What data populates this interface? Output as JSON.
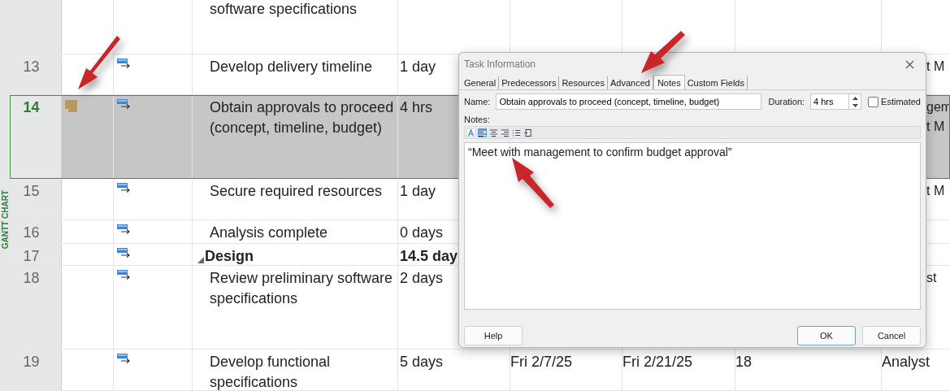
{
  "side_label": "GANTT CHART",
  "rows": [
    {
      "kind": "task",
      "selected": false,
      "name": "software specifications"
    },
    {
      "kind": "task",
      "number": "13",
      "selected": false,
      "note": false,
      "auto_scheduled": true,
      "name": "Develop delivery timeline",
      "duration": "1 day",
      "resource": [
        "t M"
      ]
    },
    {
      "kind": "task",
      "number": "14",
      "selected": true,
      "note": true,
      "auto_scheduled": true,
      "name": "Obtain approvals to proceed (concept, timeline, budget)",
      "duration": "4 hrs",
      "resource": [
        "gem",
        "t M"
      ]
    },
    {
      "kind": "task",
      "number": "15",
      "selected": false,
      "note": false,
      "auto_scheduled": true,
      "name": "Secure required resources",
      "duration": "1 day",
      "resource": [
        "t M"
      ]
    },
    {
      "kind": "task",
      "number": "16",
      "selected": false,
      "note": false,
      "auto_scheduled": true,
      "name": "Analysis complete",
      "duration": "0 days"
    },
    {
      "kind": "summary",
      "number": "17",
      "selected": false,
      "note": false,
      "expanded": true,
      "auto_scheduled": true,
      "name": "Design",
      "duration": "14.5 day"
    },
    {
      "kind": "task",
      "number": "18",
      "selected": false,
      "note": false,
      "auto_scheduled": true,
      "name": "Review preliminary software specifications",
      "duration": "2 days",
      "resource": [
        "st"
      ]
    },
    {
      "kind": "task",
      "number": "19",
      "selected": false,
      "note": false,
      "auto_scheduled": true,
      "name": "Develop functional specifications",
      "duration": "5 days",
      "start": "Fri 2/7/25",
      "finish": "Fri 2/21/25",
      "predecessors": "18",
      "resource": [
        "Analyst"
      ]
    }
  ],
  "dialog": {
    "title": "Task Information",
    "tabs": [
      {
        "label": "General",
        "selected": false
      },
      {
        "label": "Predecessors",
        "selected": false
      },
      {
        "label": "Resources",
        "selected": false
      },
      {
        "label": "Advanced",
        "selected": false
      },
      {
        "label": "Notes",
        "selected": true
      },
      {
        "label": "Custom Fields",
        "selected": false
      }
    ],
    "name_label": "Name:",
    "name_value": "Obtain approvals to proceed (concept, timeline, budget)",
    "duration_label": "Duration:",
    "duration_value": "4 hrs",
    "estimated": {
      "label": "Estimated",
      "checked": false
    },
    "notes_label": "Notes:",
    "toolbar": [
      {
        "kind": "font",
        "selected": false
      },
      {
        "kind": "align-left",
        "selected": true
      },
      {
        "kind": "align-center",
        "selected": false
      },
      {
        "kind": "align-right",
        "selected": false
      },
      {
        "kind": "bullets",
        "selected": false
      },
      {
        "kind": "insert-object",
        "selected": false
      }
    ],
    "notes_text": "“Meet with management to confirm budget approval”",
    "buttons": [
      {
        "label": "Help",
        "default": false
      },
      {
        "label": "OK",
        "default": true
      },
      {
        "label": "Cancel",
        "default": false
      }
    ]
  }
}
